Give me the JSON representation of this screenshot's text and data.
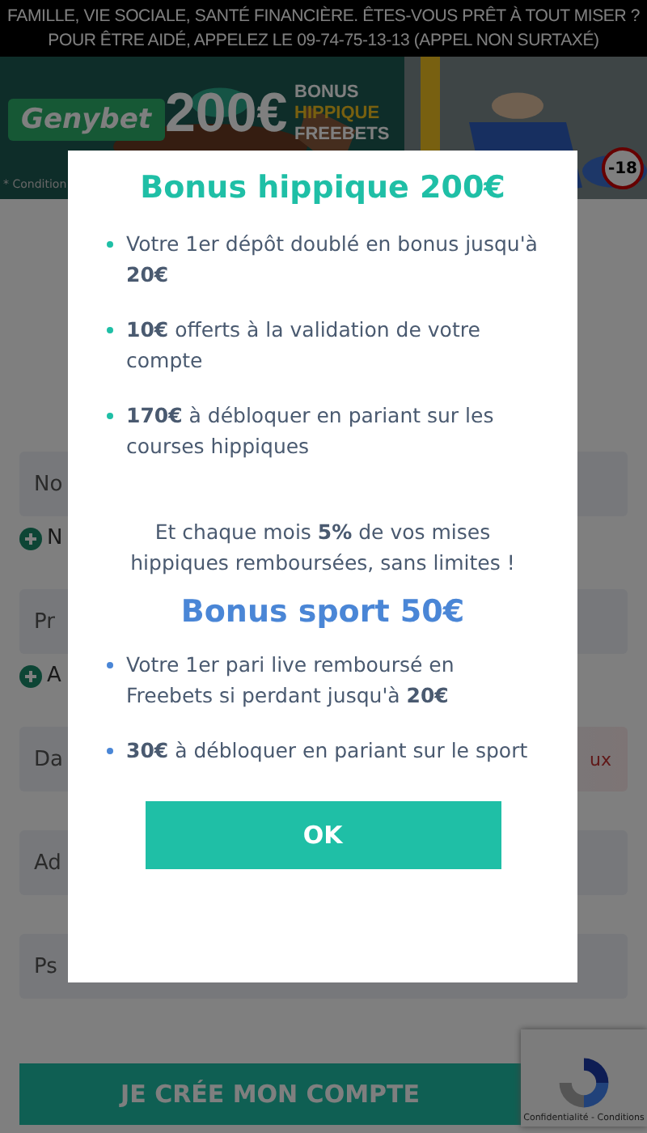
{
  "warning": {
    "lines": [
      "FAMILLE, VIE SOCIALE, SANTÉ FINANCIÈRE. ÊTES-VOUS PRÊT À TOUT MISER ?",
      "POUR ÊTRE AIDÉ, APPELEZ LE 09-74-75-13-13 (APPEL NON SURTAXÉ)"
    ]
  },
  "banner": {
    "logo": "Genybet",
    "amount": "200€",
    "bonus_lines": [
      "BONUS",
      "HIPPIQUE"
    ],
    "freebets": "FREEBETS",
    "conditions": "* Condition",
    "age": "-18",
    "kind": "picture"
  },
  "form": {
    "fields": [
      {
        "label": "No",
        "link": "N"
      },
      {
        "label": "Pr",
        "link": "A"
      },
      {
        "label": "Da",
        "error": "ux"
      },
      {
        "label": "Ad"
      },
      {
        "label": "Ps"
      }
    ],
    "submit": "JE CRÉE MON COMPTE"
  },
  "recaptcha": {
    "text": "Confidentialité - Conditions"
  },
  "modal": {
    "sections": [
      {
        "kind": "hippique",
        "title": "Bonus hippique 200€",
        "bullets": [
          "Votre 1er dépôt doublé en bonus jusqu'à **20€**",
          "**10€** offerts à la validation de votre compte",
          "**170€** à débloquer en pariant sur les courses hippiques"
        ],
        "note": "Et chaque mois **5%** de vos mises hippiques remboursées, sans limites !"
      },
      {
        "kind": "sport",
        "title": "Bonus sport 50€",
        "bullets": [
          "Votre 1er pari live remboursé en Freebets si perdant jusqu'à **20€**",
          "**30€** à débloquer en pariant sur le sport"
        ]
      }
    ],
    "button": "OK"
  }
}
